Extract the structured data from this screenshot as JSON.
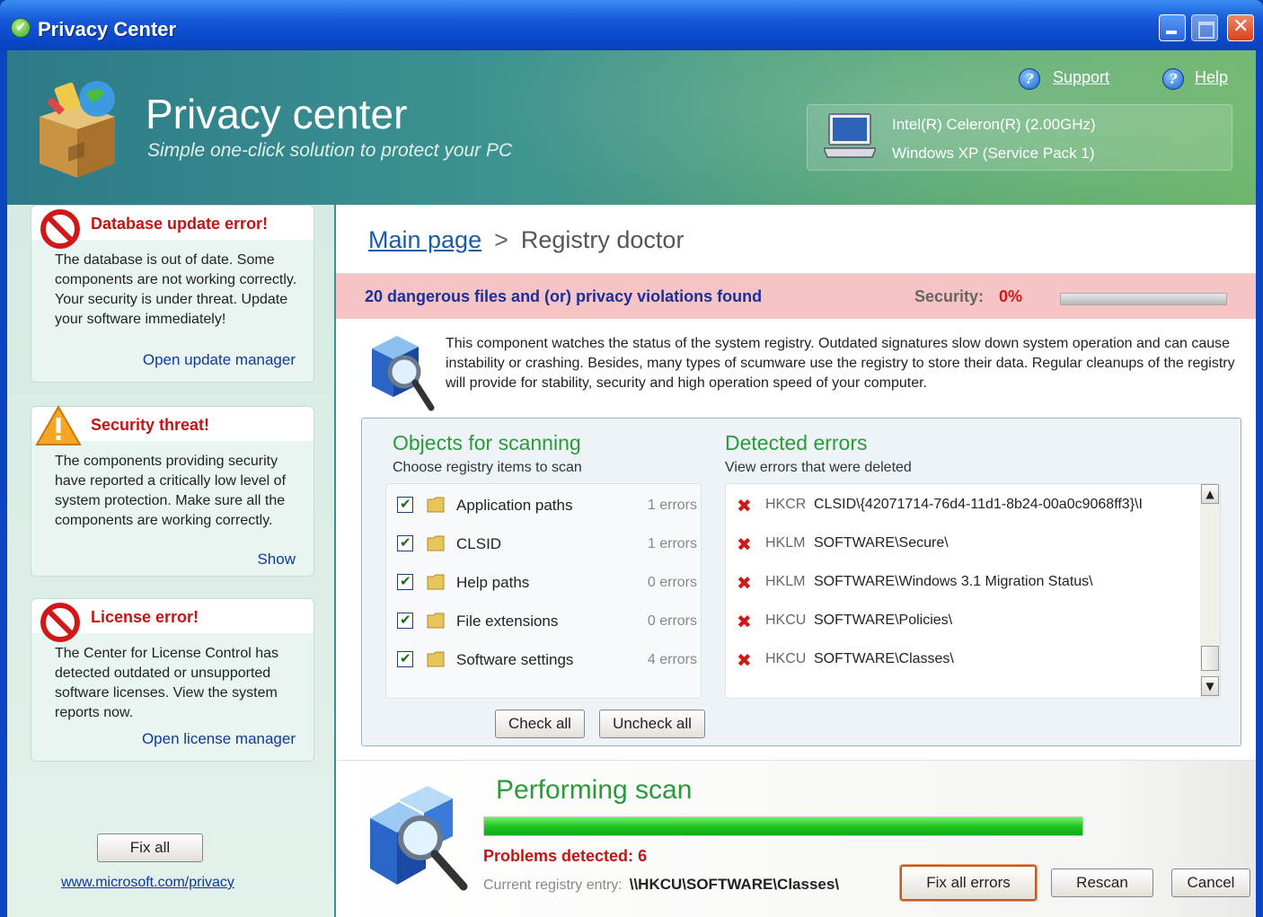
{
  "window": {
    "title": "Privacy Center"
  },
  "header": {
    "app_name": "Privacy center",
    "tagline": "Simple one-click solution to protect your PC",
    "support_label": "Support",
    "help_label": "Help",
    "cpu": "Intel(R) Celeron(R) (2.00GHz)",
    "os": "Windows XP (Service Pack 1)"
  },
  "sidebar": {
    "alerts": [
      {
        "title": "Database update error!",
        "text": "The database is out of date. Some components are not working correctly. Your security is under threat. Update your software immediately!",
        "link": "Open update manager"
      },
      {
        "title": "Security threat!",
        "text": "The components providing security have reported a critically low level of system protection. Make sure all the components are working correctly.",
        "link": "Show"
      },
      {
        "title": "License error!",
        "text": "The Center for License Control has detected outdated or unsupported software licenses. View the system reports now.",
        "link": "Open license manager"
      }
    ],
    "fix_all_label": "Fix all",
    "footer_link": "www.microsoft.com/privacy"
  },
  "main": {
    "breadcrumb": {
      "home": "Main page",
      "separator": ">",
      "current": "Registry doctor"
    },
    "alert_bar": {
      "text": "20 dangerous files and (or) privacy violations found",
      "security_label": "Security:",
      "security_value": "0%",
      "security_fraction": 0.0
    },
    "description": "This component watches the status of the system registry. Outdated signatures slow down system operation and can cause instability or crashing. Besides, many types of scumware use the registry to store their data. Regular cleanups of the registry will provide for stability, security and high operation speed of your computer.",
    "objects": {
      "title": "Objects for scanning",
      "subtitle": "Choose registry items to scan",
      "items": [
        {
          "name": "Application paths",
          "count": "1 errors",
          "checked": true
        },
        {
          "name": "CLSID",
          "count": "1 errors",
          "checked": true
        },
        {
          "name": "Help paths",
          "count": "0 errors",
          "checked": true
        },
        {
          "name": "File extensions",
          "count": "0 errors",
          "checked": true
        },
        {
          "name": "Software settings",
          "count": "4 errors",
          "checked": true
        }
      ],
      "check_all_label": "Check all",
      "uncheck_all_label": "Uncheck all"
    },
    "errors": {
      "title": "Detected errors",
      "subtitle": "View errors that were deleted",
      "items": [
        {
          "hive": "HKCR",
          "path": "CLSID\\{42071714-76d4-11d1-8b24-00a0c9068ff3}\\I"
        },
        {
          "hive": "HKLM",
          "path": "SOFTWARE\\Secure\\"
        },
        {
          "hive": "HKLM",
          "path": "SOFTWARE\\Windows 3.1 Migration Status\\"
        },
        {
          "hive": "HKCU",
          "path": "SOFTWARE\\Policies\\"
        },
        {
          "hive": "HKCU",
          "path": "SOFTWARE\\Classes\\"
        }
      ]
    },
    "scan": {
      "title": "Performing scan",
      "progress_fraction": 1.0,
      "problems_label": "Problems detected:",
      "problems_count": "6",
      "current_label": "Current registry entry:",
      "current_value": "\\\\HKCU\\SOFTWARE\\Classes\\",
      "fix_all_errors_label": "Fix all errors",
      "rescan_label": "Rescan",
      "cancel_label": "Cancel"
    }
  },
  "colors": {
    "accent_green": "#2a9a3a",
    "alert_red": "#c41414",
    "link_blue": "#0b3a9e"
  }
}
